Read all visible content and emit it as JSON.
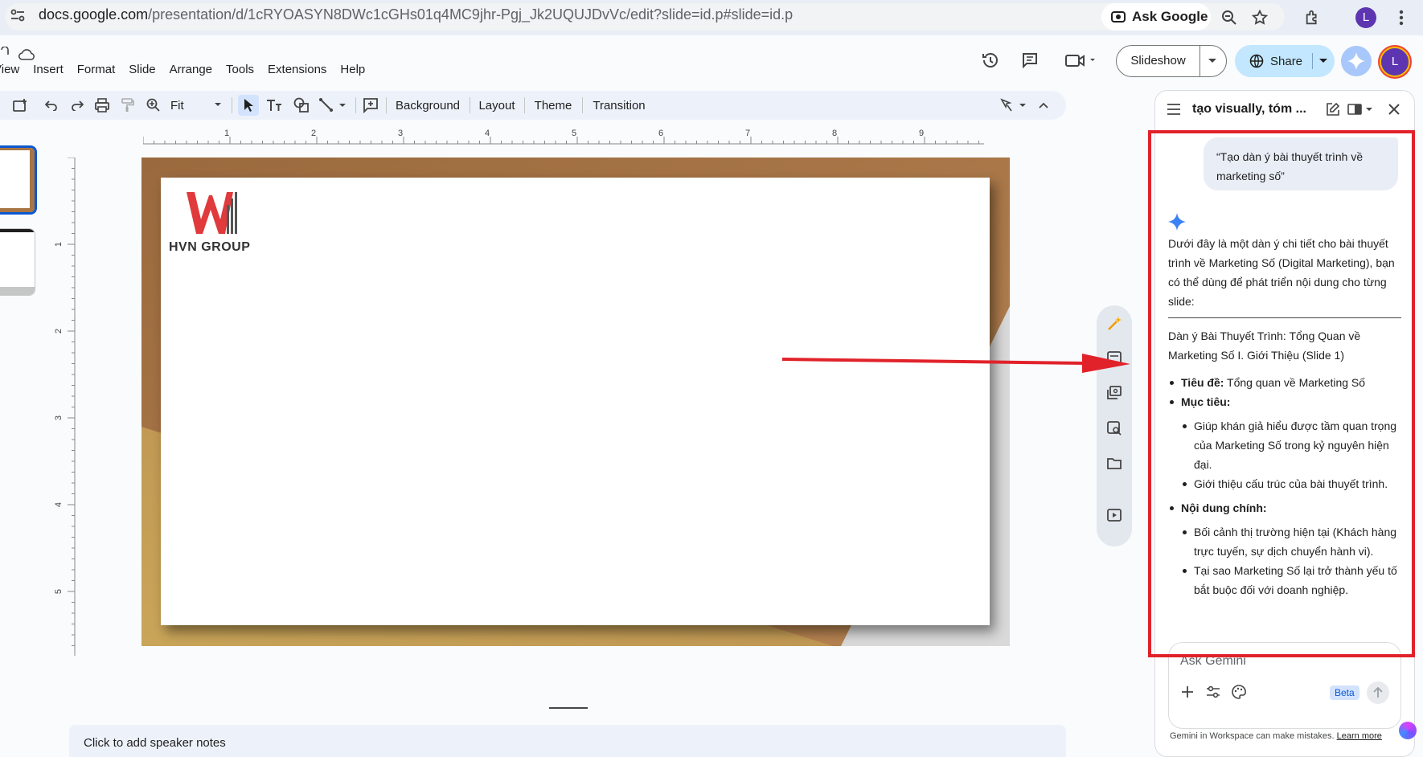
{
  "browser": {
    "url_main": "docs.google.com",
    "url_rest": "/presentation/d/1cRYOASYN8DWc1cGHs01q4MC9jhr-Pgj_Jk2UQUJDvVc/edit?slide=id.p#slide=id.p",
    "ask_google": "Ask Google",
    "profile_initial": "L"
  },
  "menu": [
    "View",
    "Insert",
    "Format",
    "Slide",
    "Arrange",
    "Tools",
    "Extensions",
    "Help"
  ],
  "header": {
    "slideshow": "Slideshow",
    "share": "Share",
    "profile_initial": "L"
  },
  "toolbar": {
    "zoom": "Fit",
    "background": "Background",
    "layout": "Layout",
    "theme": "Theme",
    "transition": "Transition"
  },
  "rulers": {
    "horizontal": [
      "1",
      "2",
      "3",
      "4",
      "5",
      "6",
      "7",
      "8",
      "9"
    ],
    "vertical": [
      "1",
      "2",
      "3",
      "4",
      "5"
    ]
  },
  "slide": {
    "logo_text": "HVN GROUP"
  },
  "notes": {
    "placeholder": "Click to add speaker notes"
  },
  "gemini": {
    "title": "tạo visually, tóm ...",
    "user_prompt": "“Tạo dàn ý bài thuyết trình về marketing số”",
    "intro": "Dưới đây là một dàn ý chi tiết cho bài thuyết trình về Marketing Số (Digital Marketing), bạn có thể dùng để phát triển nội dung cho từng slide:",
    "outline_heading": "Dàn ý Bài Thuyết Trình: Tổng Quan về Marketing Số I. Giới Thiệu (Slide 1)",
    "title_label": "Tiêu đề:",
    "title_value": " Tổng quan về Marketing Số",
    "goals_label": "Mục tiêu:",
    "goals": [
      "Giúp khán giả hiểu được tầm quan trọng của Marketing Số trong kỷ nguyên hiện đại.",
      "Giới thiệu cấu trúc của bài thuyết trình."
    ],
    "content_label": "Nội dung chính:",
    "content": [
      "Bối cảnh thị trường hiện tại (Khách hàng trực tuyến, sự dịch chuyển hành vi).",
      "Tại sao Marketing Số lại trở thành yếu tố bắt buộc đối với doanh nghiệp."
    ],
    "input_placeholder": "Ask Gemini",
    "beta": "Beta",
    "disclaimer": "Gemini in Workspace can make mistakes.",
    "learn_more": "Learn more"
  },
  "colors": {
    "accent_blue": "#0b57d0",
    "share_bg": "#c2e7ff",
    "annotation_red": "#e1222a",
    "slide_frame": "#a87544"
  }
}
